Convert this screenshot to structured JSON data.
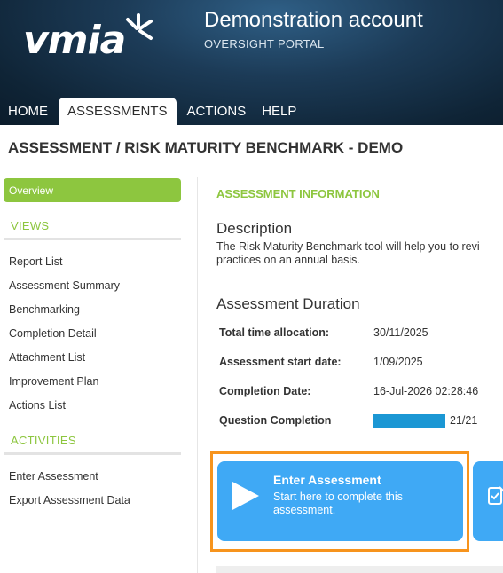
{
  "header": {
    "logo_text": "vmia",
    "account_title": "Demonstration account",
    "portal_subtitle": "OVERSIGHT PORTAL"
  },
  "nav": {
    "items": [
      {
        "label": "HOME"
      },
      {
        "label": "ASSESSMENTS",
        "active": true
      },
      {
        "label": "ACTIONS"
      },
      {
        "label": "HELP"
      }
    ]
  },
  "page": {
    "title": "ASSESSMENT / RISK MATURITY BENCHMARK - DEMO"
  },
  "sidebar": {
    "overview_label": "Overview",
    "views_heading": "VIEWS",
    "views": [
      {
        "label": "Report List"
      },
      {
        "label": "Assessment Summary"
      },
      {
        "label": "Benchmarking"
      },
      {
        "label": "Completion Detail"
      },
      {
        "label": "Attachment List"
      },
      {
        "label": "Improvement Plan"
      },
      {
        "label": "Actions List"
      }
    ],
    "activities_heading": "ACTIVITIES",
    "activities": [
      {
        "label": "Enter Assessment"
      },
      {
        "label": "Export Assessment Data"
      }
    ]
  },
  "main": {
    "section_label": "ASSESSMENT INFORMATION",
    "description": {
      "title": "Description",
      "line1": "The Risk Maturity Benchmark tool will help you to revi",
      "line2": "practices on an annual basis."
    },
    "duration": {
      "title": "Assessment Duration",
      "rows": [
        {
          "label": "Total time allocation:",
          "value": "30/11/2025"
        },
        {
          "label": "Assessment start date:",
          "value": "1/09/2025"
        },
        {
          "label": "Completion Date:",
          "value": "16-Jul-2026 02:28:46"
        },
        {
          "label": "Question Completion",
          "value": "21/21",
          "progress": 1.0
        }
      ]
    },
    "enter_card": {
      "title": "Enter Assessment",
      "description": "Start here to complete this assessment.",
      "icon": "play-icon"
    },
    "next_card": {
      "icon": "checklist-edit-icon"
    }
  },
  "colors": {
    "accent_green": "#8dc63f",
    "card_blue": "#3fa9f5",
    "progress_blue": "#1b97d4",
    "highlight_orange": "#f7941d"
  }
}
